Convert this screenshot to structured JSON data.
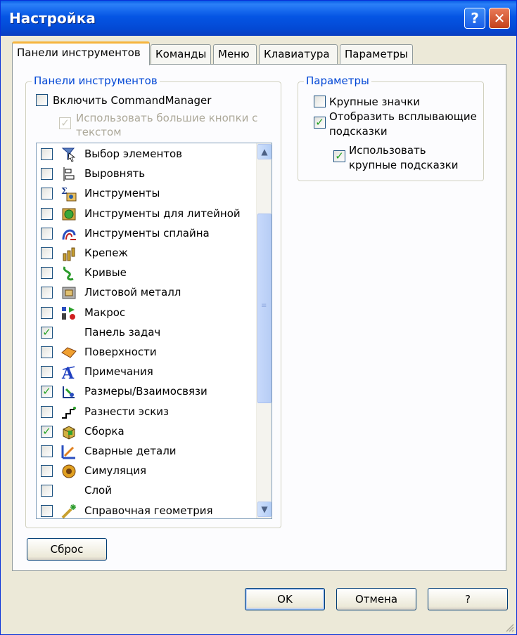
{
  "window": {
    "title": "Настройка"
  },
  "tabs": [
    {
      "label": "Панели инструментов",
      "active": true
    },
    {
      "label": "Команды"
    },
    {
      "label": "Меню"
    },
    {
      "label": "Клавиатура"
    },
    {
      "label": "Параметры"
    }
  ],
  "toolbars_group": {
    "title": "Панели инструментов",
    "enable_cm": {
      "label": "Включить CommandManager",
      "checked": false
    },
    "large_buttons": {
      "label_line1": "Использовать большие кнопки с",
      "label_line2": "текстом",
      "checked": true,
      "disabled": true
    },
    "list": [
      {
        "label": "Выбор элементов",
        "checked": false,
        "icon": "select-icon"
      },
      {
        "label": "Выровнять",
        "checked": false,
        "icon": "align-icon"
      },
      {
        "label": "Инструменты",
        "checked": false,
        "icon": "tools-icon"
      },
      {
        "label": "Инструменты для литейной",
        "checked": false,
        "icon": "mold-tools-icon"
      },
      {
        "label": "Инструменты сплайна",
        "checked": false,
        "icon": "spline-tools-icon"
      },
      {
        "label": "Крепеж",
        "checked": false,
        "icon": "fastener-icon"
      },
      {
        "label": "Кривые",
        "checked": false,
        "icon": "curves-icon"
      },
      {
        "label": "Листовой металл",
        "checked": false,
        "icon": "sheet-metal-icon"
      },
      {
        "label": "Макрос",
        "checked": false,
        "icon": "macro-icon"
      },
      {
        "label": "Панель задач",
        "checked": true,
        "icon": ""
      },
      {
        "label": "Поверхности",
        "checked": false,
        "icon": "surfaces-icon"
      },
      {
        "label": "Примечания",
        "checked": false,
        "icon": "annotations-icon"
      },
      {
        "label": "Размеры/Взаимосвязи",
        "checked": true,
        "icon": "dimensions-icon"
      },
      {
        "label": "Разнести эскиз",
        "checked": false,
        "icon": "explode-sketch-icon"
      },
      {
        "label": "Сборка",
        "checked": true,
        "icon": "assembly-icon"
      },
      {
        "label": "Сварные детали",
        "checked": false,
        "icon": "weldments-icon"
      },
      {
        "label": "Симуляция",
        "checked": false,
        "icon": "simulation-icon"
      },
      {
        "label": "Слой",
        "checked": false,
        "icon": ""
      },
      {
        "label": "Справочная геометрия",
        "checked": false,
        "icon": "reference-geometry-icon"
      }
    ]
  },
  "options_group": {
    "title": "Параметры",
    "large_icons": {
      "label": "Крупные значки",
      "checked": false
    },
    "show_tooltips": {
      "label_line1": "Отобразить всплывающие",
      "label_line2": "подсказки",
      "checked": true
    },
    "large_tooltips": {
      "label_line1": "Использовать",
      "label_line2": "крупные подсказки",
      "checked": true
    }
  },
  "buttons": {
    "reset": "Сброс",
    "ok": "OK",
    "cancel": "Отмена",
    "help": "?"
  }
}
